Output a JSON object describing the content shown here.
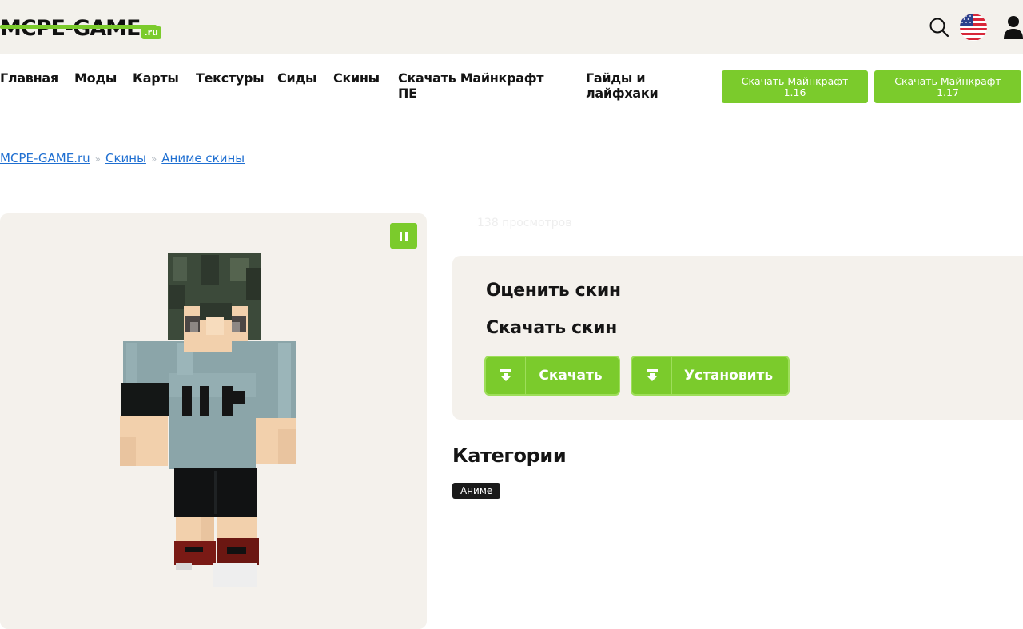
{
  "header": {
    "logo_main": "MCPE-GAME",
    "logo_suffix": ".ru",
    "icons": {
      "search": "search-icon",
      "language": "us-flag-icon",
      "account": "user-icon"
    }
  },
  "nav": {
    "items": [
      {
        "label": "Главная"
      },
      {
        "label": "Моды"
      },
      {
        "label": "Карты"
      },
      {
        "label": "Текстуры"
      },
      {
        "label": "Сиды"
      },
      {
        "label": "Скины"
      },
      {
        "label_line1": "Скачать Майнкрафт",
        "label_line2": "ПЕ"
      },
      {
        "label_line1": "Гайды и",
        "label_line2": "лайфхаки"
      }
    ],
    "buttons": [
      {
        "line1": "Скачать Майнкрафт",
        "line2": "1.16"
      },
      {
        "line1": "Скачать Майнкрафт",
        "line2": "1.17"
      }
    ]
  },
  "breadcrumb": {
    "items": [
      "MCPE-GAME.ru",
      "Скины",
      "Аниме скины"
    ],
    "separator": "»"
  },
  "preview": {
    "pause_icon": "pause-icon",
    "image": "minecraft-skin-anime-boy"
  },
  "views": "138 просмотров",
  "panel": {
    "rate_title": "Оценить скин",
    "download_title": "Скачать скин",
    "download_label": "Скачать",
    "install_label": "Установить"
  },
  "categories": {
    "title": "Категории",
    "tags": [
      "Аниме"
    ]
  },
  "colors": {
    "accent": "#7bcb2c",
    "header_bg": "#f3f1ec",
    "panel_bg": "#f4f1ec",
    "link": "#1f6fd1",
    "tag_bg": "#1a1a1a"
  }
}
